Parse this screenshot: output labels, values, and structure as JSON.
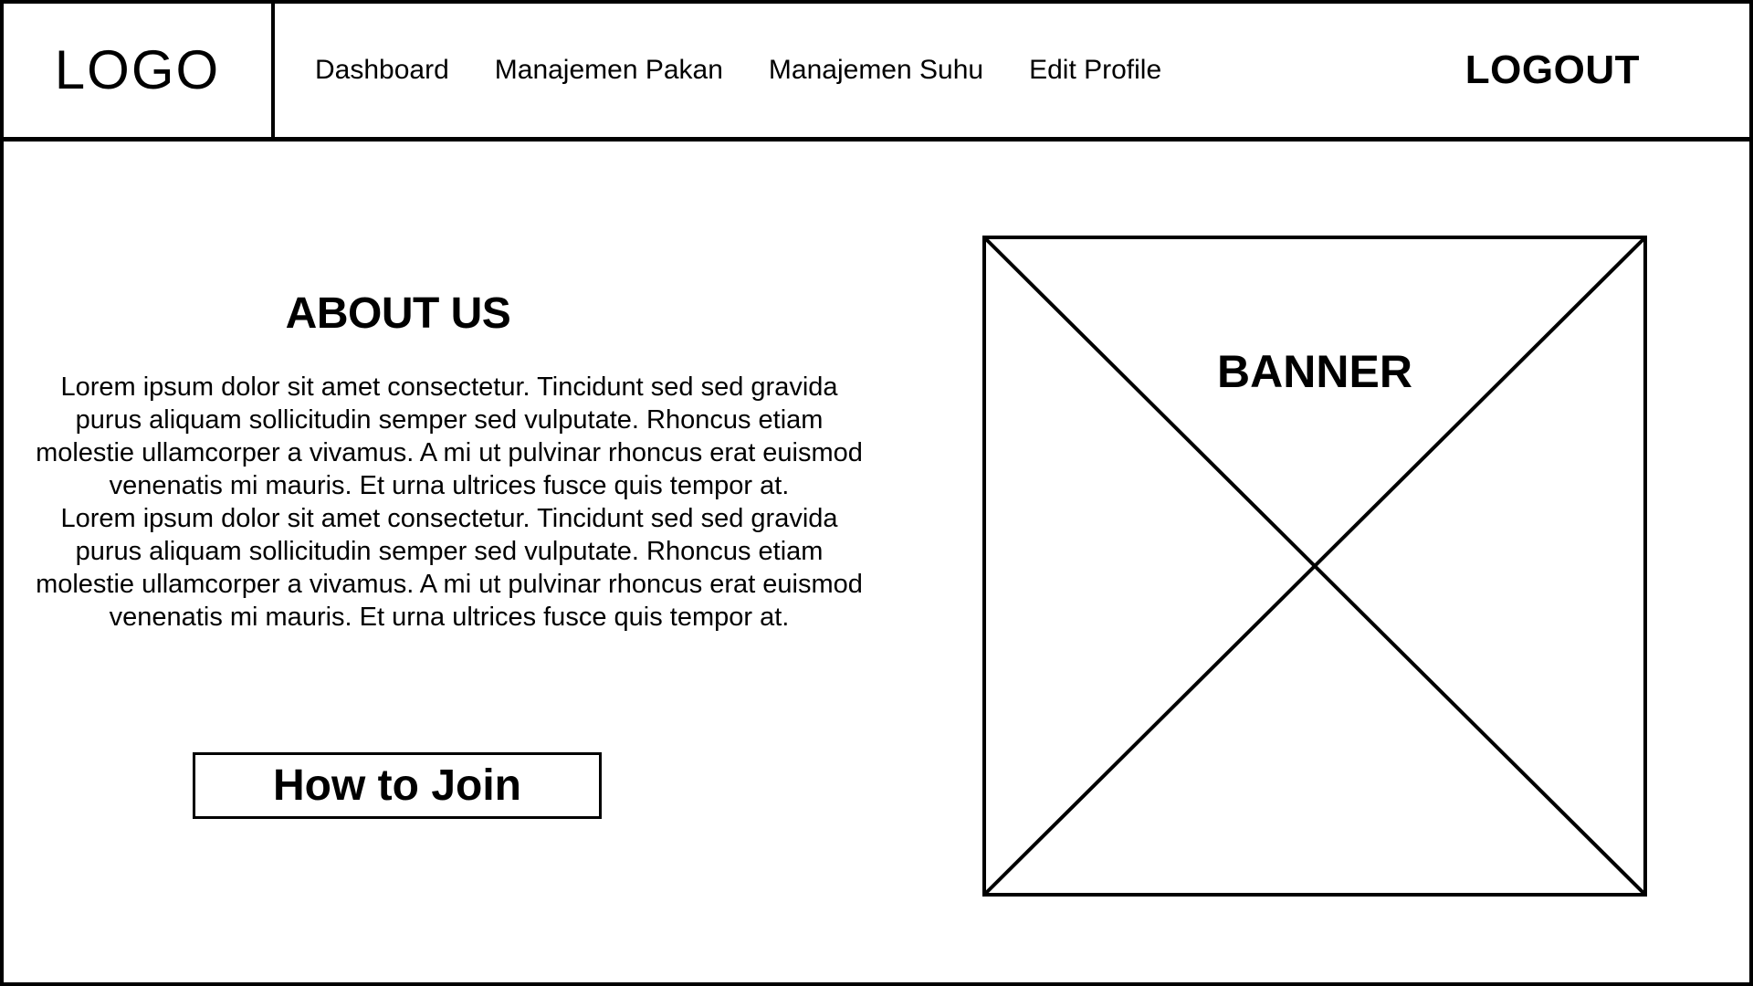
{
  "header": {
    "logo": "LOGO",
    "nav": [
      {
        "label": "Dashboard"
      },
      {
        "label": "Manajemen Pakan"
      },
      {
        "label": "Manajemen Suhu"
      },
      {
        "label": "Edit Profile"
      }
    ],
    "logout_label": "LOGOUT"
  },
  "about": {
    "title": "ABOUT US",
    "paragraphs": [
      "Lorem ipsum dolor sit amet consectetur. Tincidunt sed sed gravida purus aliquam sollicitudin semper sed vulputate. Rhoncus etiam molestie ullamcorper a vivamus. A mi ut pulvinar rhoncus erat euismod venenatis mi mauris. Et urna ultrices fusce quis tempor at.",
      "Lorem ipsum dolor sit amet consectetur. Tincidunt sed sed gravida purus aliquam sollicitudin semper sed vulputate. Rhoncus etiam molestie ullamcorper a vivamus. A mi ut pulvinar rhoncus erat euismod venenatis mi mauris. Et urna ultrices fusce quis tempor at."
    ],
    "button_label": "How to Join"
  },
  "banner": {
    "label": "BANNER"
  },
  "colors": {
    "background": "#ffffff",
    "ink": "#000000"
  }
}
